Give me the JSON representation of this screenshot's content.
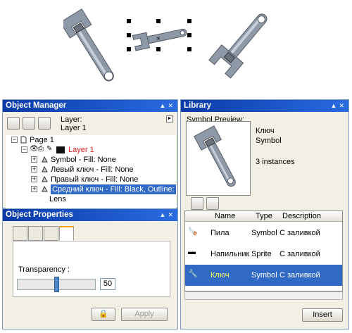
{
  "canvas": {
    "objects": [
      "wrench-left",
      "wrench-middle-selected",
      "wrench-right"
    ]
  },
  "object_manager": {
    "title": "Object Manager",
    "layer_label": "Layer:",
    "layer_value": "Layer 1",
    "tree": [
      {
        "label": "Page 1"
      },
      {
        "label": "Layer 1",
        "color": "#e02020"
      },
      {
        "label": "Symbol - Fill: None"
      },
      {
        "label": "Левый ключ - Fill: None"
      },
      {
        "label": "Правый ключ - Fill: None"
      },
      {
        "label": "Средний ключ - Fill: Black, Outline:",
        "selected": true
      },
      {
        "label": "Lens"
      }
    ]
  },
  "object_properties": {
    "title": "Object Properties",
    "transparency_label": "Transparency :",
    "transparency_value": "50",
    "transparency_fraction": 0.5,
    "apply_label": "Apply"
  },
  "library": {
    "title": "Library",
    "preview_label": "Symbol Preview:",
    "symbol_name": "Ключ",
    "symbol_type": "Symbol",
    "instances": "3 instances",
    "columns": [
      "Name",
      "Type",
      "Description"
    ],
    "rows": [
      {
        "name": "Пила",
        "type": "Symbol",
        "desc": "С заливкой",
        "selected": false
      },
      {
        "name": "Напильник",
        "type": "Sprite",
        "desc": "С заливкой",
        "selected": false
      },
      {
        "name": "Ключ",
        "type": "Symbol",
        "desc": "С заливкой",
        "selected": true
      }
    ],
    "insert_label": "Insert"
  },
  "colors": {
    "title_bar": "#0a3aa8",
    "selection": "#316ac5",
    "panel_bg": "#f2efe4",
    "layer_red": "#e02020"
  }
}
